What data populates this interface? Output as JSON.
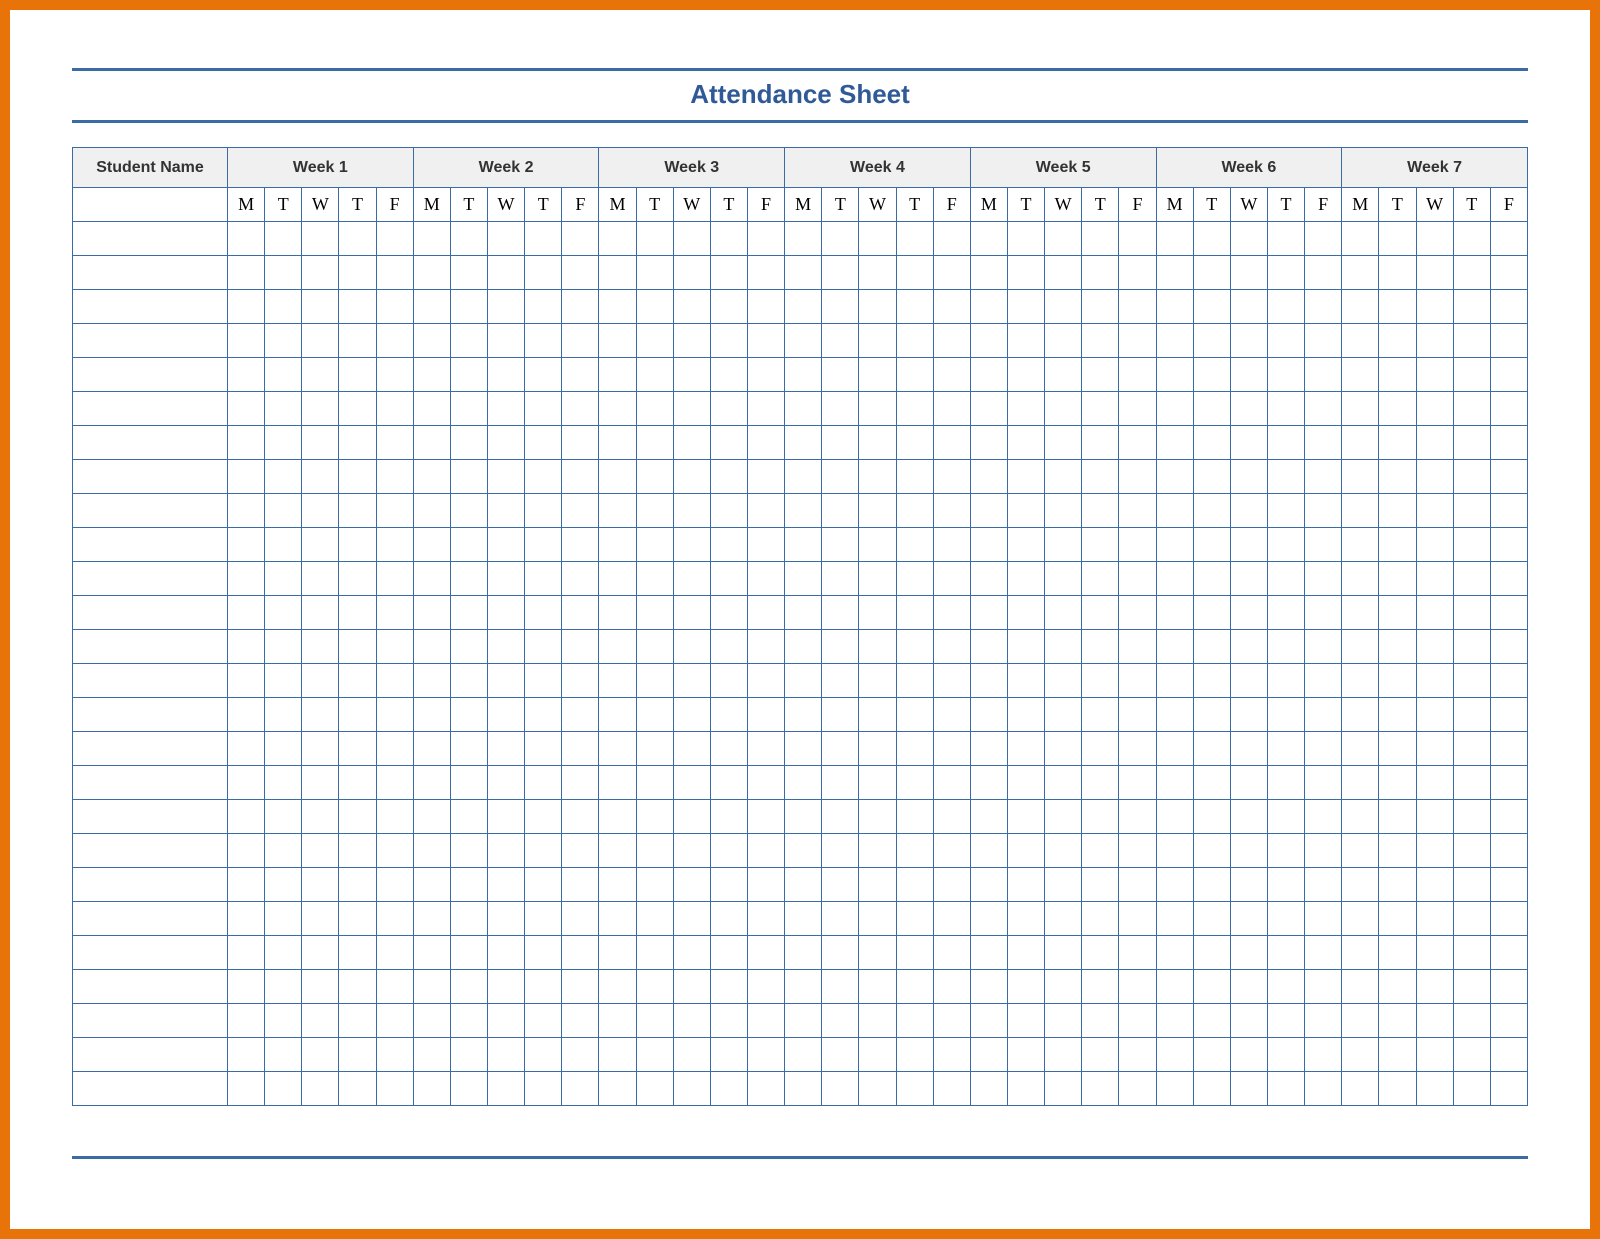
{
  "title": "Attendance Sheet",
  "columns": {
    "student_name_label": "Student Name",
    "weeks": [
      {
        "label": "Week 1",
        "days": [
          "M",
          "T",
          "W",
          "T",
          "F"
        ]
      },
      {
        "label": "Week 2",
        "days": [
          "M",
          "T",
          "W",
          "T",
          "F"
        ]
      },
      {
        "label": "Week 3",
        "days": [
          "M",
          "T",
          "W",
          "T",
          "F"
        ]
      },
      {
        "label": "Week 4",
        "days": [
          "M",
          "T",
          "W",
          "T",
          "F"
        ]
      },
      {
        "label": "Week 5",
        "days": [
          "M",
          "T",
          "W",
          "T",
          "F"
        ]
      },
      {
        "label": "Week 6",
        "days": [
          "M",
          "T",
          "W",
          "T",
          "F"
        ]
      },
      {
        "label": "Week 7",
        "days": [
          "M",
          "T",
          "W",
          "T",
          "F"
        ]
      }
    ]
  },
  "row_count": 26,
  "colors": {
    "frame_border": "#e87409",
    "rule_blue": "#3b6ba5",
    "header_fill": "#f0f0f0",
    "title_text": "#2f5a97"
  }
}
